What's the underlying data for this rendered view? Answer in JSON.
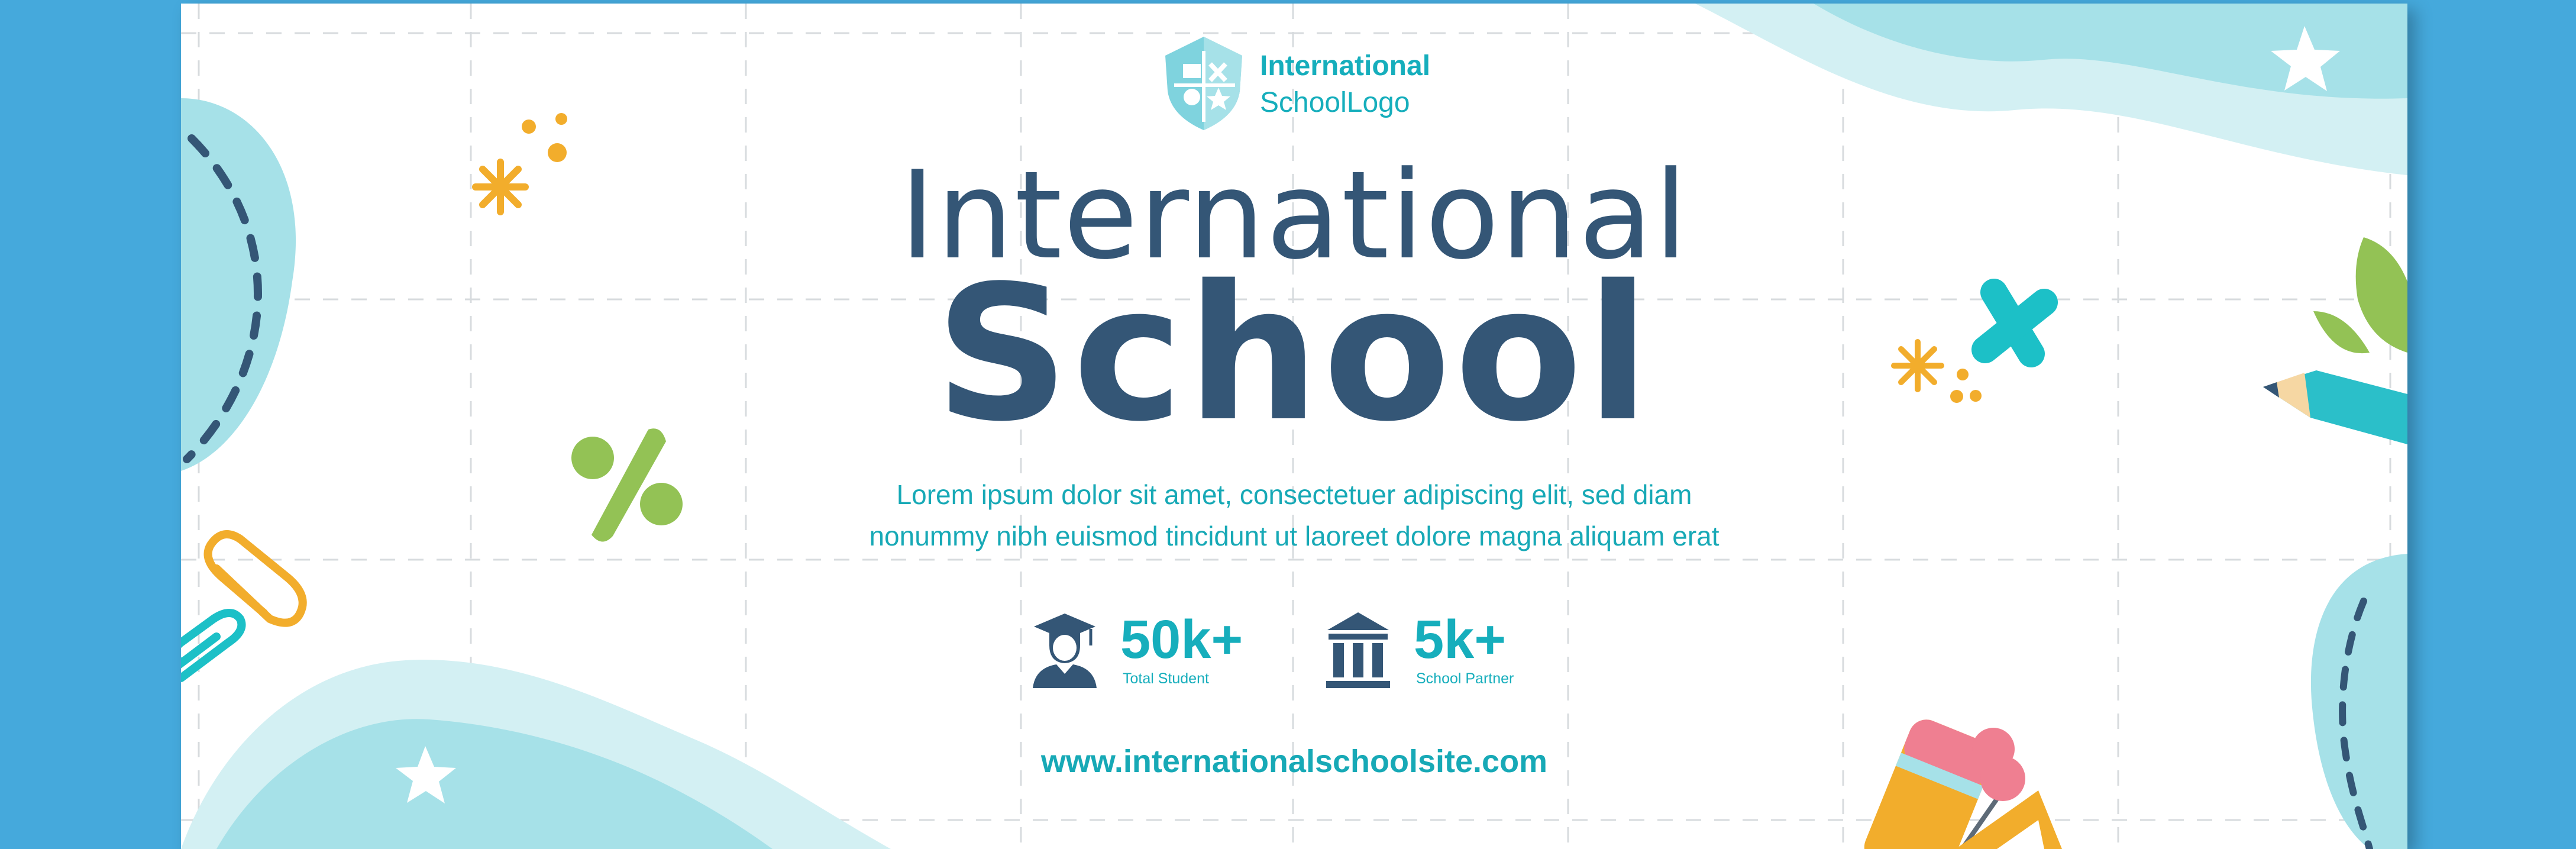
{
  "logo": {
    "icon": "shield-crest-icon",
    "line1": "International",
    "line2": "SchoolLogo"
  },
  "heading": {
    "line1": "International",
    "line2": "School"
  },
  "description": {
    "line1": "Lorem ipsum dolor sit amet, consectetuer adipiscing elit, sed diam",
    "line2": "nonummy nibh euismod tincidunt ut laoreet dolore magna aliquam erat"
  },
  "stats": [
    {
      "icon": "graduate-icon",
      "value": "50k+",
      "label": "Total Student"
    },
    {
      "icon": "institution-building-icon",
      "value": "5k+",
      "label": "School Partner"
    }
  ],
  "website": "www.internationalschoolsite.com",
  "colors": {
    "page_background": "#45a9dc",
    "banner_background": "#ffffff",
    "heading": "#345676",
    "accent_teal": "#16aebc",
    "light_cyan": "#a6e1e8",
    "orange": "#f2ad2c",
    "green": "#93c255",
    "pink": "#ef7f91"
  }
}
